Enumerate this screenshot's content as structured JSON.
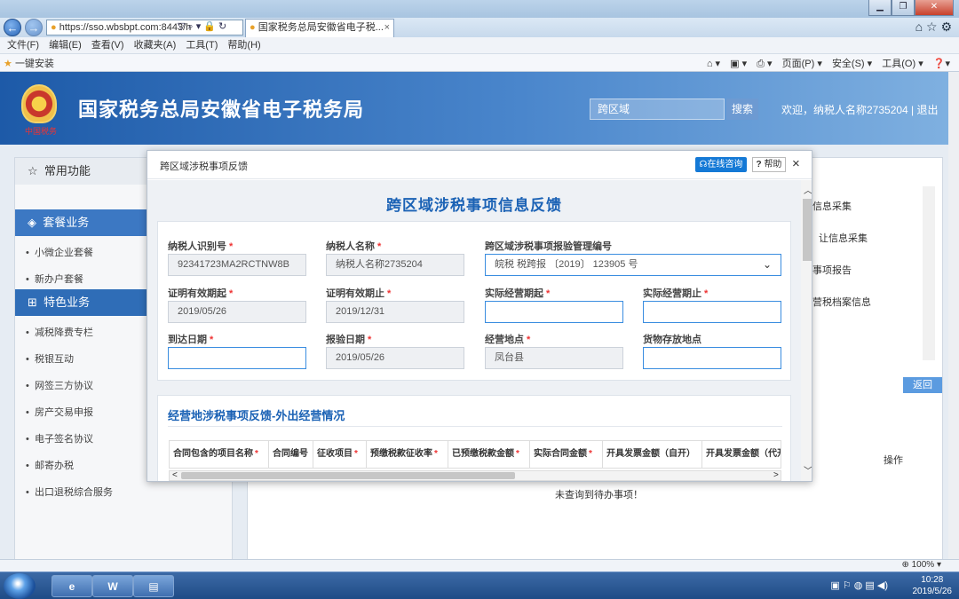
{
  "browser": {
    "url": "https://sso.wbsbpt.com:8443/h",
    "tab_title": "国家税务总局安徽省电子税...",
    "tab_close": "×",
    "menu": [
      "文件(F)",
      "编辑(E)",
      "查看(V)",
      "收藏夹(A)",
      "工具(T)",
      "帮助(H)"
    ],
    "fav_item": "一键安装",
    "right_tools": [
      "页面(P) ▾",
      "安全(S) ▾",
      "工具(O) ▾"
    ],
    "zoom": "100%"
  },
  "site": {
    "emblem_text": "中国税务",
    "title": "国家税务总局安徽省电子税务局",
    "search_placeholder": "跨区域",
    "search_button": "搜索",
    "welcome": "欢迎，纳税人名称2735204  |  退出"
  },
  "sidebar": {
    "common": "常用功能",
    "package": "套餐业务",
    "package_items": [
      "小微企业套餐",
      "新办户套餐"
    ],
    "special": "特色业务",
    "special_items": [
      "减税降费专栏",
      "税银互动",
      "网签三方协议",
      "房产交易申报",
      "电子签名协议",
      "邮寄办税",
      "出口退税综合服务"
    ]
  },
  "background": {
    "list": [
      "信息采集",
      "）让信息采集",
      "事项报告",
      "营税档案信息"
    ],
    "back_button": "返回",
    "action_col": "操作",
    "empty": "未查询到待办事项！"
  },
  "modal": {
    "title": "跨区域涉税事项反馈",
    "consult": "在线咨询",
    "help": "帮助",
    "close": "×",
    "form_title": "跨区域涉税事项信息反馈",
    "fields": {
      "taxpayer_id": {
        "label": "纳税人识别号",
        "value": "92341723MA2RCTNW8B"
      },
      "taxpayer_name": {
        "label": "纳税人名称",
        "value": "纳税人名称2735204"
      },
      "report_no": {
        "label": "跨区域涉税事项报验管理编号",
        "value": "皖税 税跨报 〔2019〕 123905 号"
      },
      "cert_start": {
        "label": "证明有效期起",
        "value": "2019/05/26"
      },
      "cert_end": {
        "label": "证明有效期止",
        "value": "2019/12/31"
      },
      "op_start": {
        "label": "实际经营期起",
        "value": ""
      },
      "op_end": {
        "label": "实际经营期止",
        "value": ""
      },
      "arrive": {
        "label": "到达日期",
        "value": ""
      },
      "verify": {
        "label": "报验日期",
        "value": "2019/05/26"
      },
      "place": {
        "label": "经营地点",
        "value": "凤台县"
      },
      "storage": {
        "label": "货物存放地点",
        "value": ""
      }
    },
    "section2_title": "经营地涉税事项反馈-外出经营情况",
    "table_headers": [
      {
        "text": "合同包含的项目名称",
        "req": true
      },
      {
        "text": "合同编号",
        "req": false
      },
      {
        "text": "征收项目",
        "req": true
      },
      {
        "text": "预缴税款征收率",
        "req": true
      },
      {
        "text": "已预缴税款金额",
        "req": true
      },
      {
        "text": "实际合同金额",
        "req": true
      },
      {
        "text": "开具发票金额（自开）",
        "req": false
      },
      {
        "text": "开具发票金额（代开）",
        "req": false
      }
    ]
  },
  "taskbar": {
    "time": "10:28",
    "date": "2019/5/26"
  }
}
